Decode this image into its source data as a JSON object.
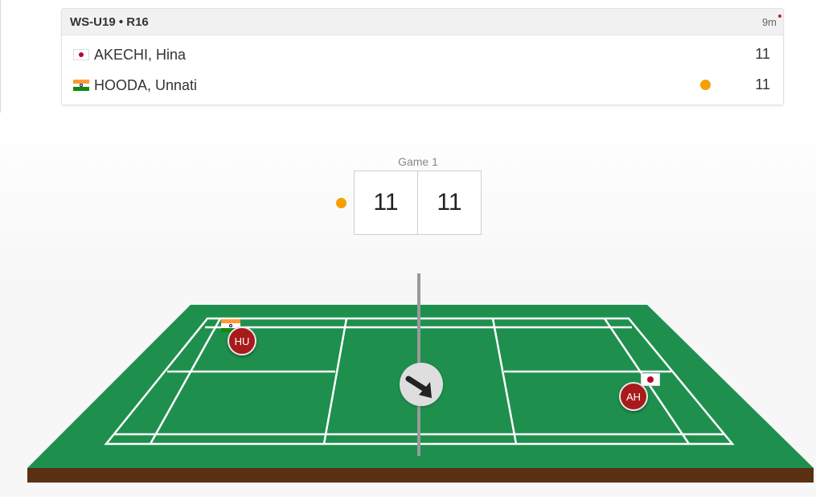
{
  "match": {
    "event_round": "WS-U19 • R16",
    "elapsed": "9m",
    "players": [
      {
        "name": "AKECHI, Hina",
        "country": "Japan",
        "flag_icon": "japan-flag-icon",
        "score": "11",
        "serving": false
      },
      {
        "name": "HOODA, Unnati",
        "country": "India",
        "flag_icon": "india-flag-icon",
        "score": "11",
        "serving": true
      }
    ]
  },
  "game": {
    "label": "Game 1",
    "scores": [
      "11",
      "11"
    ]
  },
  "court": {
    "markers": [
      {
        "initials": "HU",
        "flag_icon": "india-flag-icon"
      },
      {
        "initials": "AH",
        "flag_icon": "japan-flag-icon"
      }
    ],
    "direction_icon": "arrow-down-right-icon"
  },
  "colors": {
    "serve_indicator": "#f5a000",
    "court_green": "#1f8f4e",
    "court_base": "#5a2f12",
    "player_marker": "#a81b1b",
    "live_dot": "#d21e1e"
  }
}
